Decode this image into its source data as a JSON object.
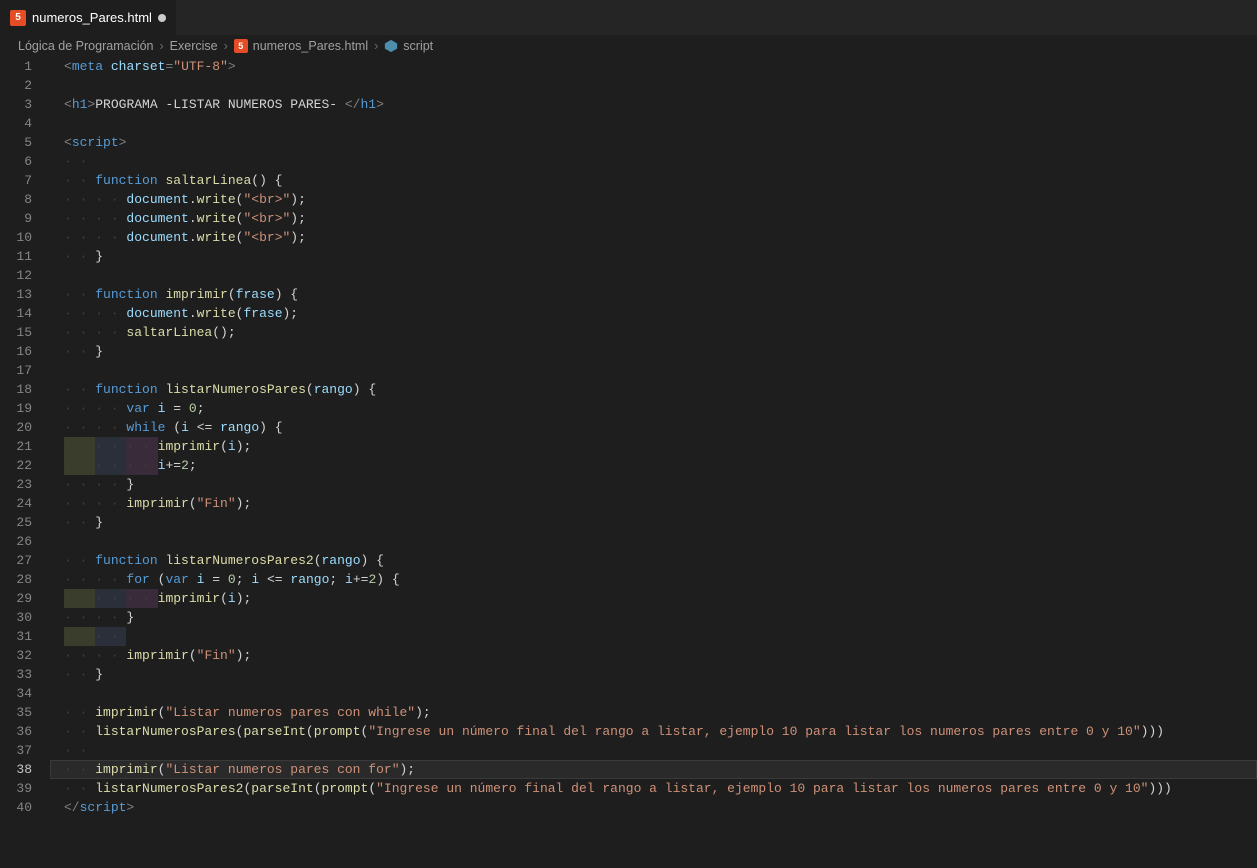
{
  "tab": {
    "icon": "html5",
    "filename": "numeros_Pares.html",
    "modified": true
  },
  "breadcrumbs": {
    "items": [
      {
        "label": "Lógica de Programación",
        "icon": null
      },
      {
        "label": "Exercise",
        "icon": null
      },
      {
        "label": "numeros_Pares.html",
        "icon": "html5"
      },
      {
        "label": "script",
        "icon": "symbol"
      }
    ]
  },
  "editor": {
    "current_line": 38,
    "line_count": 40,
    "code_lines": [
      {
        "n": 1,
        "indent": 0,
        "tokens": [
          [
            "pun",
            "<"
          ],
          [
            "tag",
            "meta"
          ],
          [
            "text",
            " "
          ],
          [
            "attr",
            "charset"
          ],
          [
            "pun",
            "="
          ],
          [
            "str",
            "\"UTF-8\""
          ],
          [
            "pun",
            ">"
          ]
        ]
      },
      {
        "n": 2,
        "indent": 0,
        "tokens": []
      },
      {
        "n": 3,
        "indent": 0,
        "tokens": [
          [
            "pun",
            "<"
          ],
          [
            "tag",
            "h1"
          ],
          [
            "pun",
            ">"
          ],
          [
            "text",
            "PROGRAMA -LISTAR NUMEROS PARES- "
          ],
          [
            "pun",
            "</"
          ],
          [
            "tag",
            "h1"
          ],
          [
            "pun",
            ">"
          ]
        ]
      },
      {
        "n": 4,
        "indent": 0,
        "tokens": []
      },
      {
        "n": 5,
        "indent": 0,
        "tokens": [
          [
            "pun",
            "<"
          ],
          [
            "tag",
            "script"
          ],
          [
            "pun",
            ">"
          ]
        ]
      },
      {
        "n": 6,
        "indent": 1,
        "tokens": []
      },
      {
        "n": 7,
        "indent": 1,
        "tokens": [
          [
            "kw",
            "function"
          ],
          [
            "text",
            " "
          ],
          [
            "fn",
            "saltarLinea"
          ],
          [
            "op",
            "() {"
          ]
        ]
      },
      {
        "n": 8,
        "indent": 2,
        "tokens": [
          [
            "var",
            "document"
          ],
          [
            "op",
            "."
          ],
          [
            "fn",
            "write"
          ],
          [
            "op",
            "("
          ],
          [
            "str",
            "\"<br>\""
          ],
          [
            "op",
            ");"
          ]
        ]
      },
      {
        "n": 9,
        "indent": 2,
        "tokens": [
          [
            "var",
            "document"
          ],
          [
            "op",
            "."
          ],
          [
            "fn",
            "write"
          ],
          [
            "op",
            "("
          ],
          [
            "str",
            "\"<br>\""
          ],
          [
            "op",
            ");"
          ]
        ]
      },
      {
        "n": 10,
        "indent": 2,
        "tokens": [
          [
            "var",
            "document"
          ],
          [
            "op",
            "."
          ],
          [
            "fn",
            "write"
          ],
          [
            "op",
            "("
          ],
          [
            "str",
            "\"<br>\""
          ],
          [
            "op",
            ");"
          ]
        ]
      },
      {
        "n": 11,
        "indent": 1,
        "tokens": [
          [
            "op",
            "}"
          ]
        ]
      },
      {
        "n": 12,
        "indent": 0,
        "tokens": []
      },
      {
        "n": 13,
        "indent": 1,
        "tokens": [
          [
            "kw",
            "function"
          ],
          [
            "text",
            " "
          ],
          [
            "fn",
            "imprimir"
          ],
          [
            "op",
            "("
          ],
          [
            "var",
            "frase"
          ],
          [
            "op",
            ") {"
          ]
        ]
      },
      {
        "n": 14,
        "indent": 2,
        "tokens": [
          [
            "var",
            "document"
          ],
          [
            "op",
            "."
          ],
          [
            "fn",
            "write"
          ],
          [
            "op",
            "("
          ],
          [
            "var",
            "frase"
          ],
          [
            "op",
            ");"
          ]
        ]
      },
      {
        "n": 15,
        "indent": 2,
        "tokens": [
          [
            "fn",
            "saltarLinea"
          ],
          [
            "op",
            "();"
          ]
        ]
      },
      {
        "n": 16,
        "indent": 1,
        "tokens": [
          [
            "op",
            "}"
          ]
        ]
      },
      {
        "n": 17,
        "indent": 0,
        "tokens": []
      },
      {
        "n": 18,
        "indent": 1,
        "tokens": [
          [
            "kw",
            "function"
          ],
          [
            "text",
            " "
          ],
          [
            "fn",
            "listarNumerosPares"
          ],
          [
            "op",
            "("
          ],
          [
            "var",
            "rango"
          ],
          [
            "op",
            ") {"
          ]
        ]
      },
      {
        "n": 19,
        "indent": 2,
        "tokens": [
          [
            "kw",
            "var"
          ],
          [
            "text",
            " "
          ],
          [
            "var",
            "i"
          ],
          [
            "text",
            " "
          ],
          [
            "op",
            "="
          ],
          [
            "text",
            " "
          ],
          [
            "num",
            "0"
          ],
          [
            "op",
            ";"
          ]
        ]
      },
      {
        "n": 20,
        "indent": 2,
        "tokens": [
          [
            "kw",
            "while"
          ],
          [
            "text",
            " "
          ],
          [
            "op",
            "("
          ],
          [
            "var",
            "i"
          ],
          [
            "text",
            " "
          ],
          [
            "op",
            "<="
          ],
          [
            "text",
            " "
          ],
          [
            "var",
            "rango"
          ],
          [
            "op",
            ") {"
          ]
        ]
      },
      {
        "n": 21,
        "indent": 3,
        "tokens": [
          [
            "fn",
            "imprimir"
          ],
          [
            "op",
            "("
          ],
          [
            "var",
            "i"
          ],
          [
            "op",
            ");"
          ]
        ]
      },
      {
        "n": 22,
        "indent": 3,
        "tokens": [
          [
            "var",
            "i"
          ],
          [
            "op",
            "+="
          ],
          [
            "num",
            "2"
          ],
          [
            "op",
            ";"
          ]
        ]
      },
      {
        "n": 23,
        "indent": 2,
        "tokens": [
          [
            "op",
            "}"
          ]
        ]
      },
      {
        "n": 24,
        "indent": 2,
        "tokens": [
          [
            "fn",
            "imprimir"
          ],
          [
            "op",
            "("
          ],
          [
            "str",
            "\"Fin\""
          ],
          [
            "op",
            ");"
          ]
        ]
      },
      {
        "n": 25,
        "indent": 1,
        "tokens": [
          [
            "op",
            "}"
          ]
        ]
      },
      {
        "n": 26,
        "indent": 0,
        "tokens": []
      },
      {
        "n": 27,
        "indent": 1,
        "tokens": [
          [
            "kw",
            "function"
          ],
          [
            "text",
            " "
          ],
          [
            "fn",
            "listarNumerosPares2"
          ],
          [
            "op",
            "("
          ],
          [
            "var",
            "rango"
          ],
          [
            "op",
            ") {"
          ]
        ]
      },
      {
        "n": 28,
        "indent": 2,
        "tokens": [
          [
            "kw",
            "for"
          ],
          [
            "text",
            " "
          ],
          [
            "op",
            "("
          ],
          [
            "kw",
            "var"
          ],
          [
            "text",
            " "
          ],
          [
            "var",
            "i"
          ],
          [
            "text",
            " "
          ],
          [
            "op",
            "="
          ],
          [
            "text",
            " "
          ],
          [
            "num",
            "0"
          ],
          [
            "op",
            "; "
          ],
          [
            "var",
            "i"
          ],
          [
            "text",
            " "
          ],
          [
            "op",
            "<="
          ],
          [
            "text",
            " "
          ],
          [
            "var",
            "rango"
          ],
          [
            "op",
            "; "
          ],
          [
            "var",
            "i"
          ],
          [
            "op",
            "+="
          ],
          [
            "num",
            "2"
          ],
          [
            "op",
            ") {"
          ]
        ]
      },
      {
        "n": 29,
        "indent": 3,
        "tokens": [
          [
            "fn",
            "imprimir"
          ],
          [
            "op",
            "("
          ],
          [
            "var",
            "i"
          ],
          [
            "op",
            ");"
          ]
        ]
      },
      {
        "n": 30,
        "indent": 2,
        "tokens": [
          [
            "op",
            "}"
          ]
        ]
      },
      {
        "n": 31,
        "indent": 2,
        "tokens": []
      },
      {
        "n": 32,
        "indent": 2,
        "tokens": [
          [
            "fn",
            "imprimir"
          ],
          [
            "op",
            "("
          ],
          [
            "str",
            "\"Fin\""
          ],
          [
            "op",
            ");"
          ]
        ]
      },
      {
        "n": 33,
        "indent": 1,
        "tokens": [
          [
            "op",
            "}"
          ]
        ]
      },
      {
        "n": 34,
        "indent": 0,
        "tokens": []
      },
      {
        "n": 35,
        "indent": 1,
        "tokens": [
          [
            "fn",
            "imprimir"
          ],
          [
            "op",
            "("
          ],
          [
            "str",
            "\"Listar numeros pares con while\""
          ],
          [
            "op",
            ");"
          ]
        ]
      },
      {
        "n": 36,
        "indent": 1,
        "tokens": [
          [
            "fn",
            "listarNumerosPares"
          ],
          [
            "op",
            "("
          ],
          [
            "fn",
            "parseInt"
          ],
          [
            "op",
            "("
          ],
          [
            "fn",
            "prompt"
          ],
          [
            "op",
            "("
          ],
          [
            "str",
            "\"Ingrese un número final del rango a listar, ejemplo 10 para listar los numeros pares entre 0 y 10\""
          ],
          [
            "op",
            ")))"
          ]
        ]
      },
      {
        "n": 37,
        "indent": 1,
        "tokens": []
      },
      {
        "n": 38,
        "indent": 1,
        "tokens": [
          [
            "fn",
            "imprimir"
          ],
          [
            "op",
            "("
          ],
          [
            "str",
            "\"Listar numeros pares con for\""
          ],
          [
            "op",
            ");"
          ]
        ]
      },
      {
        "n": 39,
        "indent": 1,
        "tokens": [
          [
            "fn",
            "listarNumerosPares2"
          ],
          [
            "op",
            "("
          ],
          [
            "fn",
            "parseInt"
          ],
          [
            "op",
            "("
          ],
          [
            "fn",
            "prompt"
          ],
          [
            "op",
            "("
          ],
          [
            "str",
            "\"Ingrese un número final del rango a listar, ejemplo 10 para listar los numeros pares entre 0 y 10\""
          ],
          [
            "op",
            ")))"
          ]
        ]
      },
      {
        "n": 40,
        "indent": 0,
        "tokens": [
          [
            "pun",
            "</"
          ],
          [
            "tag",
            "script"
          ],
          [
            "pun",
            ">"
          ]
        ]
      }
    ],
    "rainbow_rows": [
      21,
      22,
      29,
      31
    ]
  }
}
